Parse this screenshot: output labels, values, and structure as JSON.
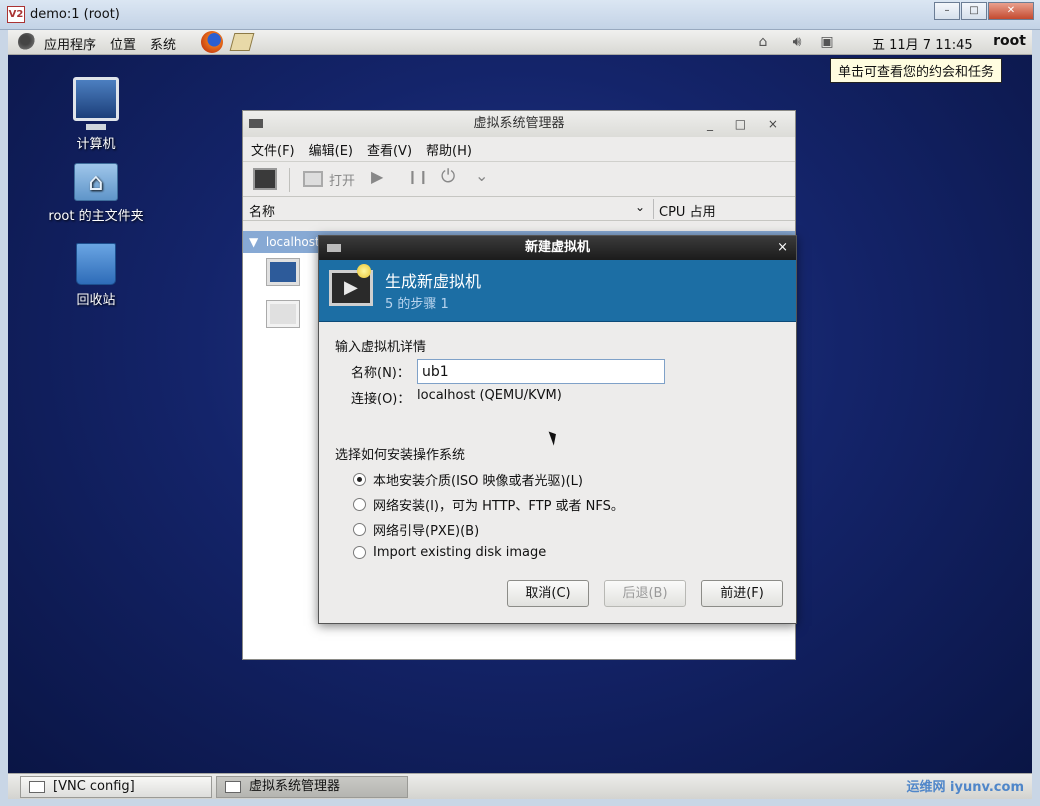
{
  "vnc_window": {
    "title": "demo:1 (root)",
    "logo": "V2",
    "ctrl_min": "–",
    "ctrl_max": "□",
    "ctrl_close": "✕"
  },
  "top_panel": {
    "menu_apps": "应用程序",
    "menu_places": "位置",
    "menu_system": "系统",
    "clock": "五 11月  7 11:45",
    "user": "root",
    "tray_icons": [
      "network-icon",
      "volume-icon",
      "network-status-icon"
    ]
  },
  "tooltip": "单击可查看您的约会和任务",
  "desktop_icons": [
    {
      "label": "计算机",
      "icon": "computer-icon"
    },
    {
      "label": "root 的主文件夹",
      "icon": "home-folder-icon"
    },
    {
      "label": "回收站",
      "icon": "trash-icon"
    }
  ],
  "vmm": {
    "title": "虚拟系统管理器",
    "window_ctrls": "_ □ ×",
    "menu": [
      "文件(F)",
      "编辑(E)",
      "查看(V)",
      "帮助(H)"
    ],
    "toolbar_open": "打开",
    "toolbar_icons": {
      "play": "▶",
      "pause": "❙❙",
      "power": "⏻",
      "dropdown": "⌄"
    },
    "col_name": "名称",
    "col_chevron": "⌄",
    "col_cpu": "CPU 占用",
    "host_row": "localhost"
  },
  "dialog": {
    "title": "新建虚拟机",
    "close": "×",
    "heading": "生成新虚拟机",
    "step": "5 的步骤 1",
    "section_details": "输入虚拟机详情",
    "name_label": "名称(N)：",
    "name_value": "ub1",
    "conn_label": "连接(O)：",
    "conn_value": "localhost (QEMU/KVM)",
    "section_install": "选择如何安装操作系统",
    "options": [
      {
        "label": "本地安装介质(ISO 映像或者光驱)(L)",
        "selected": true
      },
      {
        "label": "网络安装(I)，可为 HTTP、FTP 或者 NFS。",
        "selected": false
      },
      {
        "label": "网络引导(PXE)(B)",
        "selected": false
      },
      {
        "label": "Import existing disk image",
        "selected": false
      }
    ],
    "btn_cancel": "取消(C)",
    "btn_back": "后退(B)",
    "btn_forward": "前进(F)"
  },
  "taskbar": [
    {
      "label": "[VNC config]",
      "active": false
    },
    {
      "label": "虚拟系统管理器",
      "active": true
    }
  ],
  "watermark": "运维网 iyunv.com"
}
